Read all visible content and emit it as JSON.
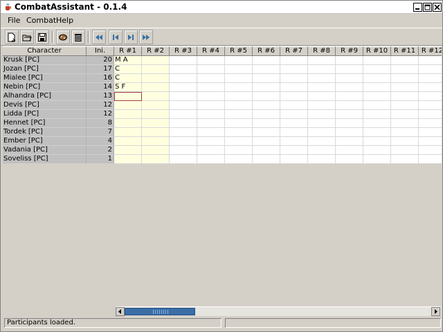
{
  "window": {
    "title": "CombatAssistant - 0.1.4"
  },
  "menu": {
    "file": "File",
    "combat": "Combat",
    "help": "Help"
  },
  "toolbar": {
    "icons": [
      "new-participant-icon",
      "open-icon",
      "save-icon",
      "dice-icon",
      "trash-icon",
      "first-round-icon",
      "previous-round-icon",
      "next-round-icon",
      "last-round-icon"
    ]
  },
  "table": {
    "headers": {
      "character": "Character",
      "ini": "Ini.",
      "rounds": [
        "R #1",
        "R #2",
        "R #3",
        "R #4",
        "R #5",
        "R #6",
        "R #7",
        "R #8",
        "R #9",
        "R #10",
        "R #11",
        "R #12"
      ]
    },
    "rows": [
      {
        "name": "Krusk [PC]",
        "ini": "20",
        "r1": "M A"
      },
      {
        "name": "Jozan [PC]",
        "ini": "17",
        "r1": "C"
      },
      {
        "name": "Mialee [PC]",
        "ini": "16",
        "r1": "C"
      },
      {
        "name": "Nebin [PC]",
        "ini": "14",
        "r1": "S F"
      },
      {
        "name": "Alhandra [PC]",
        "ini": "13",
        "r1": ""
      },
      {
        "name": "Devis [PC]",
        "ini": "12",
        "r1": ""
      },
      {
        "name": "Lidda [PC]",
        "ini": "12",
        "r1": ""
      },
      {
        "name": "Hennet [PC]",
        "ini": "8",
        "r1": ""
      },
      {
        "name": "Tordek [PC]",
        "ini": "7",
        "r1": ""
      },
      {
        "name": "Ember [PC]",
        "ini": "4",
        "r1": ""
      },
      {
        "name": "Vadania [PC]",
        "ini": "2",
        "r1": ""
      },
      {
        "name": "Soveliss [PC]",
        "ini": "1",
        "r1": ""
      }
    ]
  },
  "status": {
    "message": "Participants loaded.",
    "secondary": ""
  },
  "colors": {
    "active_round_bg": "#ffffe0",
    "name_column_bg": "#c0c0c0",
    "scroll_thumb": "#3a6ea5",
    "selection_border": "#a04040"
  }
}
